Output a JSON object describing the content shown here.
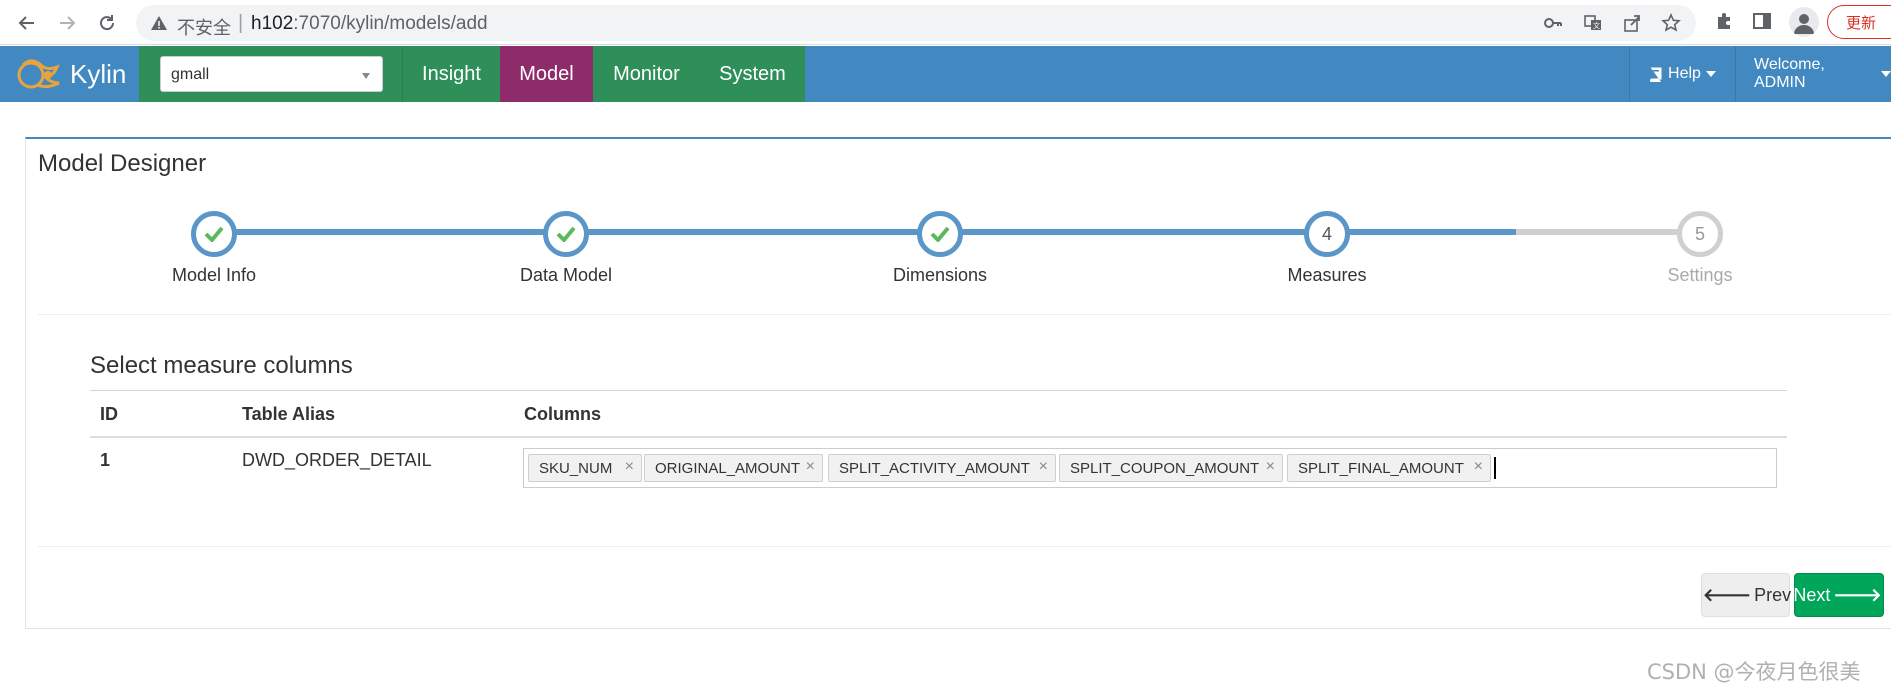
{
  "browser": {
    "insecure_label": "不安全",
    "url_host": "h102",
    "url_rest": ":7070/kylin/models/add",
    "update_label": "更新"
  },
  "navbar": {
    "brand": "Kylin",
    "project": "gmall",
    "tabs": [
      {
        "label": "Insight"
      },
      {
        "label": "Model"
      },
      {
        "label": "Monitor"
      },
      {
        "label": "System"
      }
    ],
    "active_tab": "Model",
    "help_label": "Help",
    "welcome_label": "Welcome, ADMIN"
  },
  "colors": {
    "navbar_blue": "#4189c0",
    "navbar_green": "#2f8f59",
    "active_tab": "#8e2b6b",
    "wizard_done": "#5a97c8",
    "check_green": "#5cb85c",
    "next_button": "#00a65a"
  },
  "designer": {
    "title": "Model Designer",
    "steps": [
      {
        "label": "Model Info",
        "status": "done"
      },
      {
        "label": "Data Model",
        "status": "done"
      },
      {
        "label": "Dimensions",
        "status": "done"
      },
      {
        "label": "Measures",
        "number": "4",
        "status": "current"
      },
      {
        "label": "Settings",
        "number": "5",
        "status": "todo"
      }
    ]
  },
  "measures": {
    "title": "Select measure columns",
    "headers": {
      "id": "ID",
      "alias": "Table Alias",
      "columns": "Columns"
    },
    "rows": [
      {
        "id": "1",
        "alias": "DWD_ORDER_DETAIL",
        "columns": [
          "SKU_NUM",
          "ORIGINAL_AMOUNT",
          "SPLIT_ACTIVITY_AMOUNT",
          "SPLIT_COUPON_AMOUNT",
          "SPLIT_FINAL_AMOUNT"
        ]
      }
    ]
  },
  "buttons": {
    "prev": "Prev",
    "next": "Next"
  },
  "watermark": "CSDN @今夜月色很美"
}
